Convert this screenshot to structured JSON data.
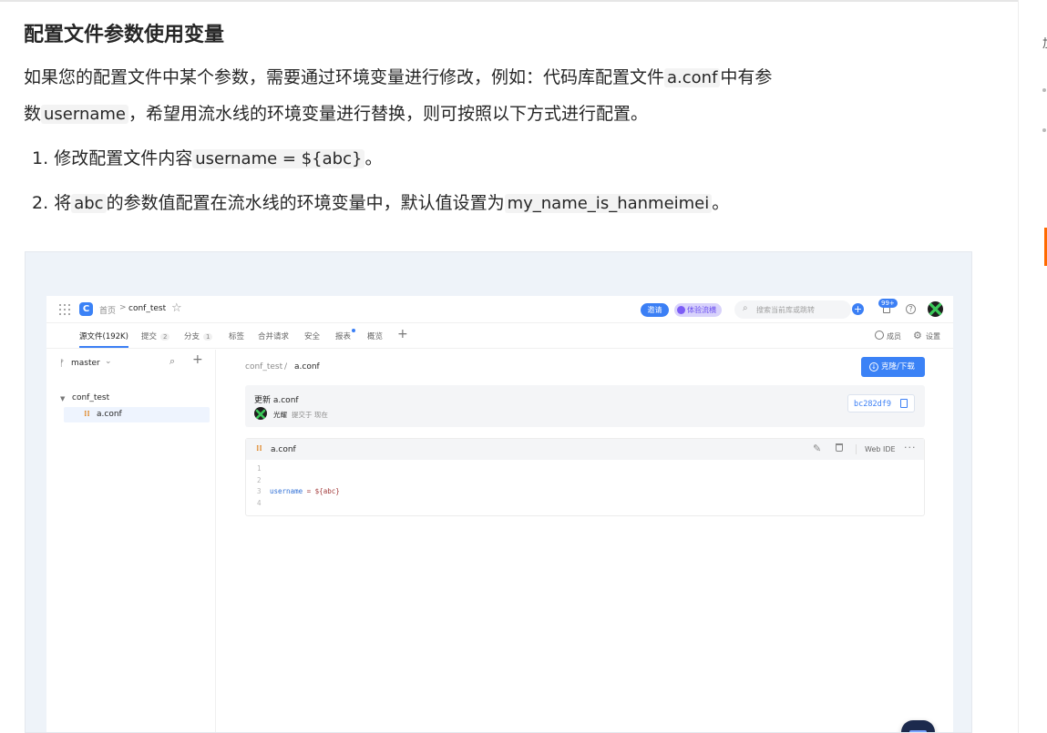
{
  "doc": {
    "title": "配置文件参数使用变量",
    "para1_a": "如果您的配置文件中某个参数，需要通过环境变量进行修改，例如：代码库配置文件",
    "para1_code": "a.conf",
    "para1_b": "中有参",
    "para2_a": "数",
    "para2_code": "username",
    "para2_b": "，希望用流水线的环境变量进行替换，则可按照以下方式进行配置。",
    "steps": [
      {
        "num": "1.",
        "a": "修改配置文件内容",
        "code": "username = ${abc}",
        "b": "。"
      },
      {
        "num": "2.",
        "a": "将",
        "code": "abc",
        "b": "的参数值配置在流水线的环境变量中，默认值设置为",
        "code2": "my_name_is_hanmeimei",
        "c": "。"
      }
    ]
  },
  "right_panel": {
    "glyph": "加"
  },
  "screenshot": {
    "header": {
      "crumb_home": "首页",
      "crumb_sep": ">",
      "crumb_repo": "conf_test",
      "invite": "邀请",
      "trial": "体验流横",
      "search_placeholder": "搜索当前库或跳转",
      "badge": "99+",
      "help": "?"
    },
    "tabs": [
      {
        "label": "源文件(192K)",
        "active": true
      },
      {
        "label": "提交",
        "count": "2"
      },
      {
        "label": "分支",
        "count": "1"
      },
      {
        "label": "标签"
      },
      {
        "label": "合并请求"
      },
      {
        "label": "安全"
      },
      {
        "label": "报表",
        "dot": true
      },
      {
        "label": "概览"
      }
    ],
    "members_label": "成员",
    "settings_label": "设置",
    "sidebar": {
      "branch": "master",
      "folder": "conf_test",
      "file": "a.conf"
    },
    "main": {
      "path_repo": "conf_test",
      "path_sep": "/",
      "path_file": "a.conf",
      "clone_label": "克隆/下载",
      "commit_message": "更新 a.conf",
      "commit_author": "光耀",
      "commit_time": "提交于 现在",
      "commit_hash": "bc282df9",
      "file_name": "a.conf",
      "web_ide": "Web IDE",
      "more": "···",
      "lines": [
        {
          "n": "1",
          "text": ""
        },
        {
          "n": "2",
          "text": ""
        },
        {
          "n": "3",
          "key": "username",
          "rest": " = ${abc}"
        },
        {
          "n": "4",
          "text": ""
        }
      ]
    }
  },
  "colors": {
    "accent": "#3b82f6",
    "orange": "#ff6a00",
    "code_bg": "#f3f3f3"
  }
}
